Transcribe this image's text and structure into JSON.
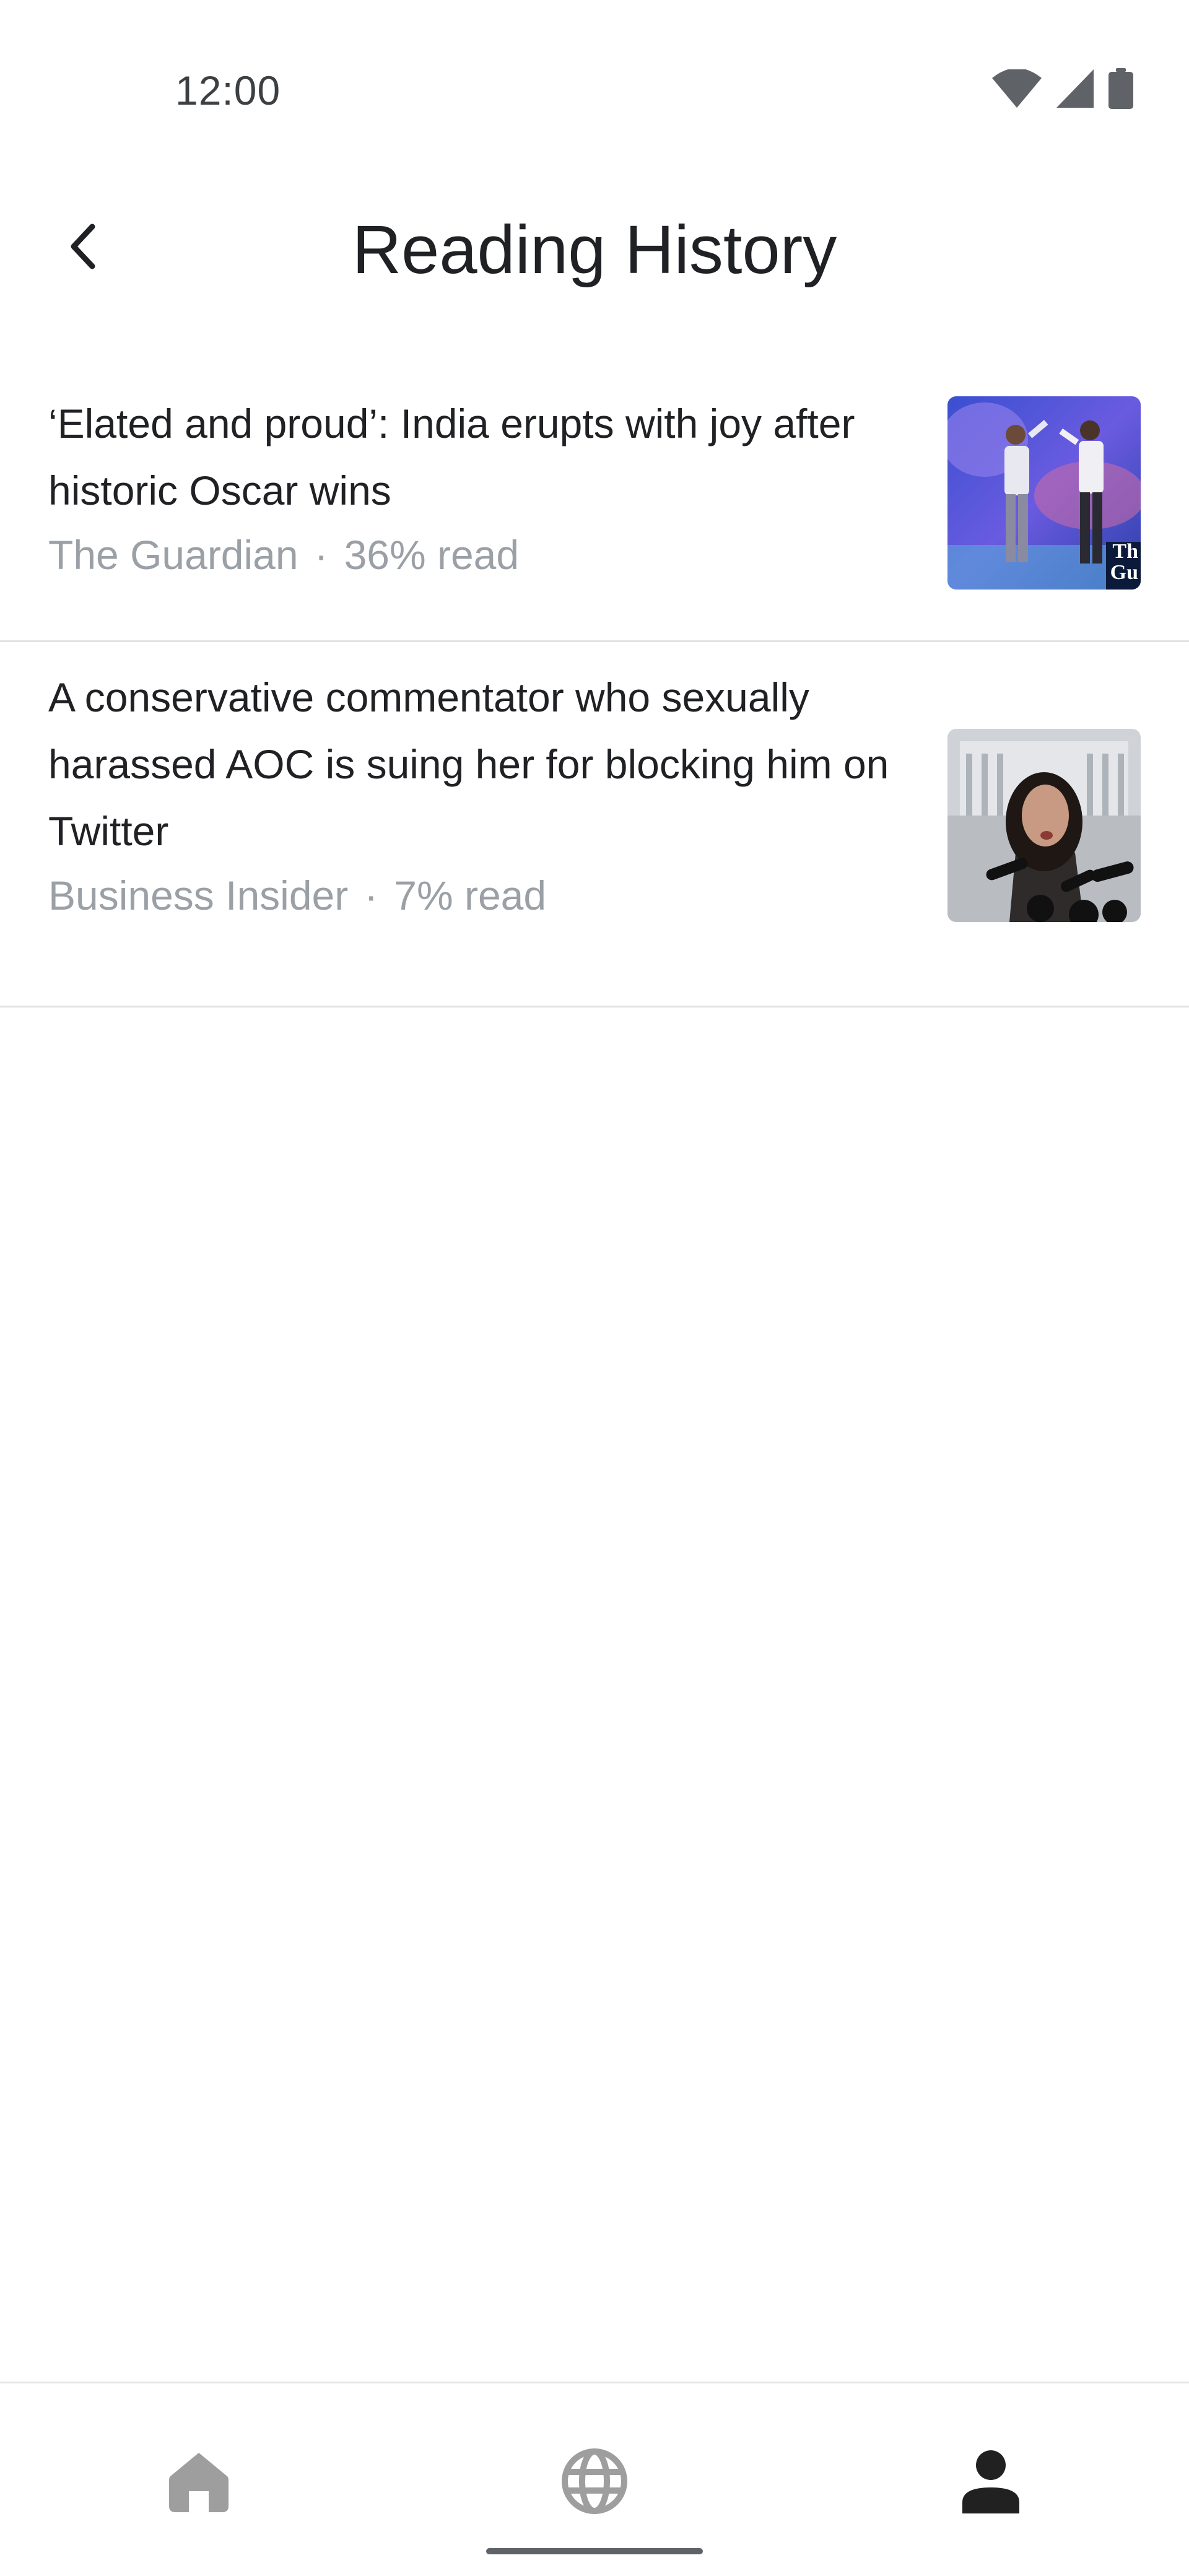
{
  "status_bar": {
    "time": "12:00",
    "icons": [
      "wifi-icon",
      "cellular-signal-icon",
      "battery-icon"
    ]
  },
  "header": {
    "title": "Reading History",
    "back_icon": "chevron-left-icon"
  },
  "articles": [
    {
      "title": "‘Elated and proud’: India erupts with joy after historic Oscar wins",
      "source": "The Guardian",
      "separator": "·",
      "progress": "36% read",
      "thumbnail_badge": "Th Gu"
    },
    {
      "title": "A conservative commentator who sexually harassed AOC is suing her for blocking him on Twitter",
      "source": "Business Insider",
      "separator": "·",
      "progress": "7% read"
    }
  ],
  "bottom_nav": {
    "items": [
      "home-icon",
      "globe-icon",
      "person-icon"
    ],
    "active": "person-icon"
  },
  "colors": {
    "text": "#202124",
    "meta": "#9aa0a6",
    "divider": "#e2e2e2",
    "nav_inactive": "#9e9e9e",
    "nav_active": "#212121"
  }
}
